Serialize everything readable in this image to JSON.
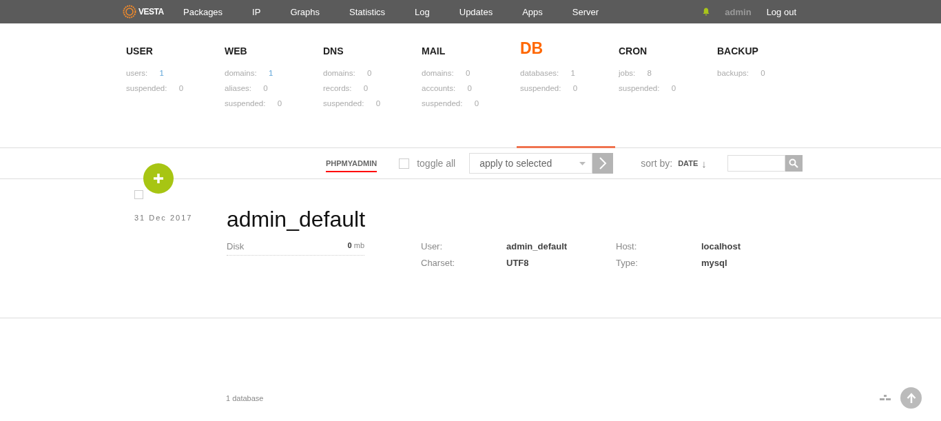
{
  "topbar": {
    "logo": "VESTA",
    "nav": [
      {
        "label": "Packages"
      },
      {
        "label": "IP"
      },
      {
        "label": "Graphs"
      },
      {
        "label": "Statistics"
      },
      {
        "label": "Log"
      },
      {
        "label": "Updates"
      },
      {
        "label": "Apps"
      },
      {
        "label": "Server"
      }
    ],
    "user": "admin",
    "logout": "Log out"
  },
  "stats": [
    {
      "title": "USER",
      "selected": false,
      "rows": [
        {
          "label": "users:",
          "value": "1",
          "link": true
        },
        {
          "label": "suspended:",
          "value": "0",
          "link": false
        }
      ]
    },
    {
      "title": "WEB",
      "selected": false,
      "rows": [
        {
          "label": "domains:",
          "value": "1",
          "link": true
        },
        {
          "label": "aliases:",
          "value": "0",
          "link": false
        },
        {
          "label": "suspended:",
          "value": "0",
          "link": false
        }
      ]
    },
    {
      "title": "DNS",
      "selected": false,
      "rows": [
        {
          "label": "domains:",
          "value": "0",
          "link": false
        },
        {
          "label": "records:",
          "value": "0",
          "link": false
        },
        {
          "label": "suspended:",
          "value": "0",
          "link": false
        }
      ]
    },
    {
      "title": "MAIL",
      "selected": false,
      "rows": [
        {
          "label": "domains:",
          "value": "0",
          "link": false
        },
        {
          "label": "accounts:",
          "value": "0",
          "link": false
        },
        {
          "label": "suspended:",
          "value": "0",
          "link": false
        }
      ]
    },
    {
      "title": "DB",
      "selected": true,
      "rows": [
        {
          "label": "databases:",
          "value": "1",
          "link": false
        },
        {
          "label": "suspended:",
          "value": "0",
          "link": false
        }
      ]
    },
    {
      "title": "CRON",
      "selected": false,
      "rows": [
        {
          "label": "jobs:",
          "value": "8",
          "link": false
        },
        {
          "label": "suspended:",
          "value": "0",
          "link": false
        }
      ]
    },
    {
      "title": "BACKUP",
      "selected": false,
      "rows": [
        {
          "label": "backups:",
          "value": "0",
          "link": false
        }
      ]
    }
  ],
  "toolbar": {
    "link": "PHPMYADMIN",
    "toggle_all": {
      "label": "toggle all",
      "checked": false
    },
    "action_select": "apply to selected",
    "sort_label": "sort by:",
    "sort_value": "DATE",
    "sort_arrow": "↓"
  },
  "item": {
    "checked": false,
    "date": "31 Dec 2017",
    "title": "admin_default",
    "disk": {
      "label": "Disk",
      "value": "0",
      "unit": "mb"
    },
    "details": [
      {
        "label": "User:",
        "value": "admin_default"
      },
      {
        "label": "Host:",
        "value": "localhost"
      },
      {
        "label": "Charset:",
        "value": "UTF8"
      },
      {
        "label": "Type:",
        "value": "mysql"
      }
    ]
  },
  "footer": "1 database"
}
